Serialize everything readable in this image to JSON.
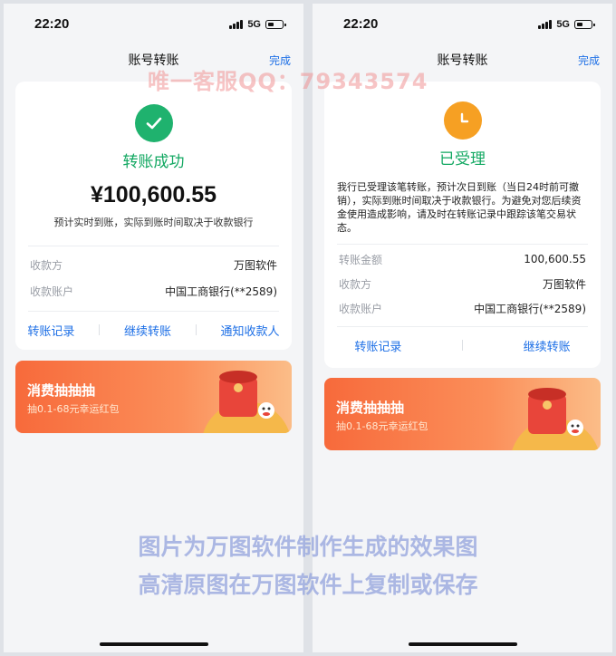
{
  "left": {
    "status_bar": {
      "time": "22:20",
      "network": "5G"
    },
    "nav": {
      "title": "账号转账",
      "done": "完成"
    },
    "result": {
      "status": "转账成功",
      "amount": "¥100,600.55",
      "subtitle": "预计实时到账，实际到账时间取决于收款银行",
      "rows": [
        {
          "label": "收款方",
          "value": "万图软件"
        },
        {
          "label": "收款账户",
          "value": "中国工商银行(**2589)"
        }
      ],
      "actions": [
        "转账记录",
        "继续转账",
        "通知收款人"
      ]
    },
    "banner": {
      "title": "消费抽抽抽",
      "subtitle": "抽0.1-68元幸运红包"
    }
  },
  "right": {
    "status_bar": {
      "time": "22:20",
      "network": "5G"
    },
    "nav": {
      "title": "账号转账",
      "done": "完成"
    },
    "result": {
      "status": "已受理",
      "notice": "我行已受理该笔转账，预计次日到账（当日24时前可撤销），实际到账时间取决于收款银行。为避免对您后续资金使用造成影响，请及时在转账记录中跟踪该笔交易状态。",
      "rows": [
        {
          "label": "转账金额",
          "value": "100,600.55"
        },
        {
          "label": "收款方",
          "value": "万图软件"
        },
        {
          "label": "收款账户",
          "value": "中国工商银行(**2589)"
        }
      ],
      "actions": [
        "转账记录",
        "继续转账"
      ]
    },
    "banner": {
      "title": "消费抽抽抽",
      "subtitle": "抽0.1-68元幸运红包"
    }
  },
  "watermarks": {
    "top": "唯一客服QQ：79343574",
    "bottom_line1": "图片为万图软件制作生成的效果图",
    "bottom_line2": "高清原图在万图软件上复制或保存"
  },
  "colors": {
    "success": "#1fb26e",
    "pending": "#f6a023",
    "link": "#1d6fe6",
    "banner": "#f76a3b"
  }
}
